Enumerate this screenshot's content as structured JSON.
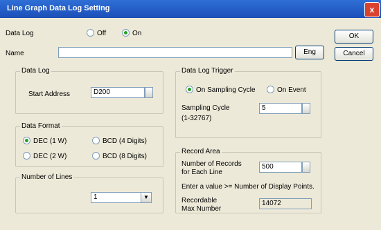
{
  "window": {
    "title": "Line Graph Data Log Setting",
    "close_symbol": "x"
  },
  "data_log": {
    "label": "Data Log",
    "off_label": "Off",
    "on_label": "On",
    "selected": "On"
  },
  "name": {
    "label": "Name",
    "value": "",
    "eng_button": "Eng"
  },
  "buttons": {
    "ok": "OK",
    "cancel": "Cancel"
  },
  "data_log_group": {
    "title": "Data Log",
    "start_address_label": "Start Address",
    "start_address_value": "D200"
  },
  "data_format": {
    "title": "Data Format",
    "options": [
      "DEC (1 W)",
      "BCD (4 Digits)",
      "DEC (2 W)",
      "BCD (8 Digits)"
    ],
    "selected": "DEC (1 W)"
  },
  "number_of_lines": {
    "title": "Number of Lines",
    "value": "1"
  },
  "trigger": {
    "title": "Data Log Trigger",
    "opt_sampling": "On Sampling Cycle",
    "opt_event": "On Event",
    "selected": "On Sampling Cycle",
    "cycle_label": "Sampling Cycle",
    "cycle_range": "(1-32767)",
    "cycle_value": "5"
  },
  "record_area": {
    "title": "Record Area",
    "records_label_1": "Number of Records",
    "records_label_2": "for Each Line",
    "records_value": "500",
    "hint": "Enter a value >= Number of Display Points.",
    "recordable_label_1": "Recordable",
    "recordable_label_2": "Max Number",
    "recordable_value": "14072"
  },
  "colors": {
    "title_bar": "#2f6fd6",
    "face": "#ece9d8",
    "radio_dot": "#21a121"
  }
}
